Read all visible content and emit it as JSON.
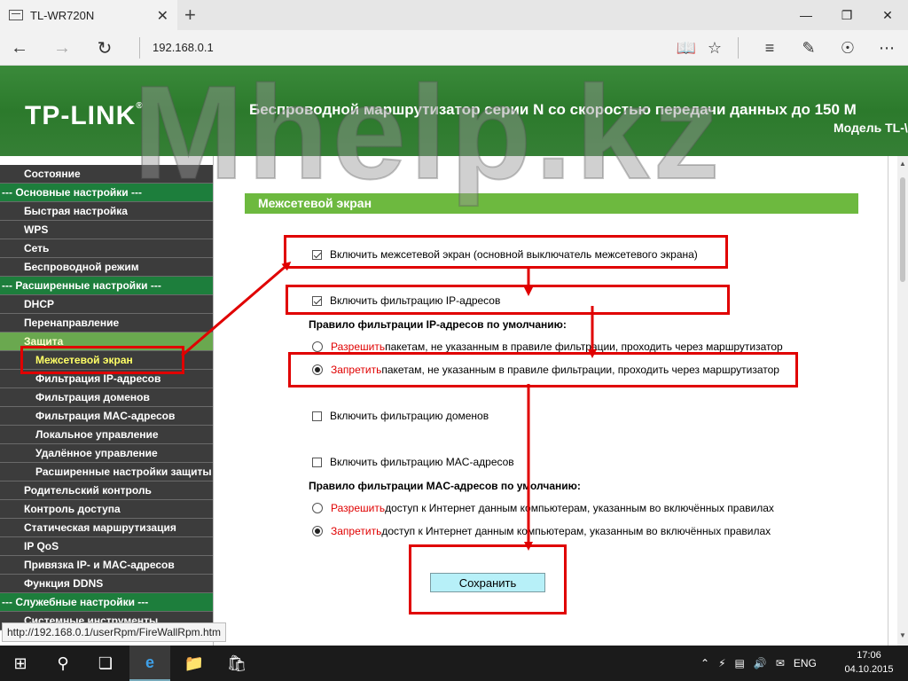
{
  "browser": {
    "tab_title": "TL-WR720N",
    "tab_close": "✕",
    "new_tab": "+",
    "address": "192.168.0.1",
    "status_url": "http://192.168.0.1/userRpm/FireWallRpm.htm"
  },
  "header": {
    "logo": "TP-LINK",
    "logo_mark": "®",
    "title": "Беспроводной маршрутизатор серии N со скоростью передачи данных до 150 М",
    "model": "Модель TL-\\"
  },
  "watermark": "Mhelp.kz",
  "menu": {
    "items": [
      {
        "label": "Состояние",
        "kind": "item"
      },
      {
        "label": "--- Основные настройки ---",
        "kind": "section"
      },
      {
        "label": "Быстрая настройка",
        "kind": "item"
      },
      {
        "label": "WPS",
        "kind": "item"
      },
      {
        "label": "Сеть",
        "kind": "item"
      },
      {
        "label": "Беспроводной режим",
        "kind": "item"
      },
      {
        "label": "--- Расширенные настройки ---",
        "kind": "section"
      },
      {
        "label": "DHCP",
        "kind": "item"
      },
      {
        "label": "Перенаправление",
        "kind": "item"
      },
      {
        "label": "Защита",
        "kind": "active-parent"
      },
      {
        "label": "Межсетевой экран",
        "kind": "active"
      },
      {
        "label": "Фильтрация IP-адресов",
        "kind": "sub"
      },
      {
        "label": "Фильтрация доменов",
        "kind": "sub"
      },
      {
        "label": "Фильтрация MAC-адресов",
        "kind": "sub"
      },
      {
        "label": "Локальное управление",
        "kind": "sub"
      },
      {
        "label": "Удалённое управление",
        "kind": "sub"
      },
      {
        "label": "Расширенные настройки защиты",
        "kind": "sub"
      },
      {
        "label": "Родительский контроль",
        "kind": "item"
      },
      {
        "label": "Контроль доступа",
        "kind": "item"
      },
      {
        "label": "Статическая маршрутизация",
        "kind": "item"
      },
      {
        "label": "IP QoS",
        "kind": "item"
      },
      {
        "label": "Привязка IP- и MAC-адресов",
        "kind": "item"
      },
      {
        "label": "Функция DDNS",
        "kind": "item"
      },
      {
        "label": "--- Служебные настройки ---",
        "kind": "section"
      },
      {
        "label": "Системные инструменты",
        "kind": "item"
      }
    ]
  },
  "content": {
    "title": "Межсетевой экран",
    "firewall_enable": {
      "label": "Включить межсетевой экран (основной выключатель межсетевого экрана)",
      "checked": true
    },
    "ip_filter_enable": {
      "label": "Включить фильтрацию IP-адресов",
      "checked": true
    },
    "ip_rule_heading": "Правило фильтрации IP-адресов по умолчанию:",
    "ip_allow": {
      "keyword": "Разрешить",
      "text": " пакетам, не указанным в правиле фильтрации, проходить через маршрутизатор",
      "checked": false
    },
    "ip_deny": {
      "keyword": "Запретить",
      "text": " пакетам, не указанным в правиле фильтрации, проходить через маршрутизатор",
      "checked": true
    },
    "domain_filter_enable": {
      "label": "Включить фильтрацию доменов",
      "checked": false
    },
    "mac_filter_enable": {
      "label": "Включить фильтрацию MAC-адресов",
      "checked": false
    },
    "mac_rule_heading": "Правило фильтрации MAC-адресов по умолчанию:",
    "mac_allow": {
      "keyword": "Разрешить",
      "text": " доступ к Интернет данным компьютерам, указанным во включённых правилах",
      "checked": false
    },
    "mac_deny": {
      "keyword": "Запретить",
      "text": " доступ к Интернет данным компьютерам, указанным во включённых правилах",
      "checked": true
    },
    "save_label": "Сохранить"
  },
  "taskbar": {
    "language": "ENG",
    "time": "17:06",
    "date": "04.10.2015"
  },
  "colors": {
    "header_green": "#2c7a2c",
    "menu_dark": "#3c3c3c",
    "menu_section": "#1d7e3c",
    "title_green": "#6db93f",
    "annotation_red": "#e00000",
    "save_button": "#b7f0f8"
  }
}
